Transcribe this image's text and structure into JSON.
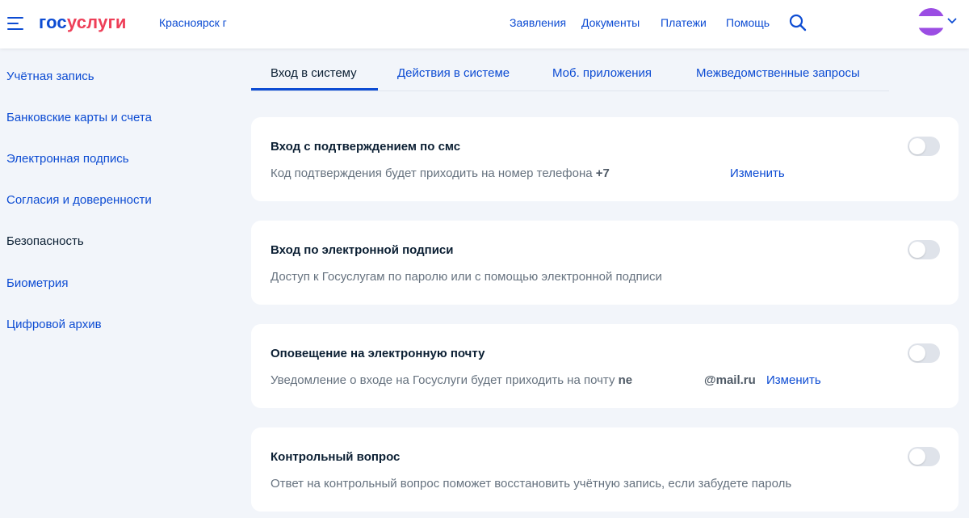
{
  "header": {
    "logo_part1": "гос",
    "logo_part2": "услуги",
    "city": "Красноярск г",
    "nav": [
      "Заявления",
      "Документы",
      "Платежи",
      "Помощь"
    ],
    "search_icon": "search-icon",
    "menu_icon": "burger-menu-icon",
    "dropdown_icon": "chevron-down-icon"
  },
  "sidebar": {
    "items": [
      {
        "label": "Учётная запись"
      },
      {
        "label": "Банковские карты и счета"
      },
      {
        "label": "Электронная подпись"
      },
      {
        "label": "Согласия и доверенности"
      },
      {
        "label": "Безопасность",
        "active": true
      },
      {
        "label": "Биометрия"
      },
      {
        "label": "Цифровой архив"
      }
    ]
  },
  "tabs": [
    {
      "label": "Вход в систему",
      "active": true
    },
    {
      "label": "Действия в системе"
    },
    {
      "label": "Моб. приложения"
    },
    {
      "label": "Межведомственные запросы"
    }
  ],
  "cards": [
    {
      "title": "Вход с подтверждением по смс",
      "desc": "Код подтверждения будет приходить на номер телефона ",
      "value": "+7",
      "link": "Изменить",
      "enabled": false
    },
    {
      "title": "Вход по электронной подписи",
      "desc": "Доступ к Госуслугам по паролю или с помощью электронной подписи",
      "enabled": false
    },
    {
      "title": "Оповещение на электронную почту",
      "desc": "Уведомление о входе на Госуслуги будет приходить на почту ",
      "value_prefix": "ne",
      "value": "@mail.ru",
      "link": "Изменить",
      "enabled": false
    },
    {
      "title": "Контрольный вопрос",
      "desc": "Ответ на контрольный вопрос поможет восстановить учётную запись, если забудете пароль",
      "enabled": false
    }
  ],
  "colors": {
    "accent": "#0d4cd3",
    "brand_red": "#ee3f58",
    "background": "#f2f5fa",
    "text": "#0b1f33",
    "muted": "#66727f",
    "avatar": "#9b4de3"
  }
}
